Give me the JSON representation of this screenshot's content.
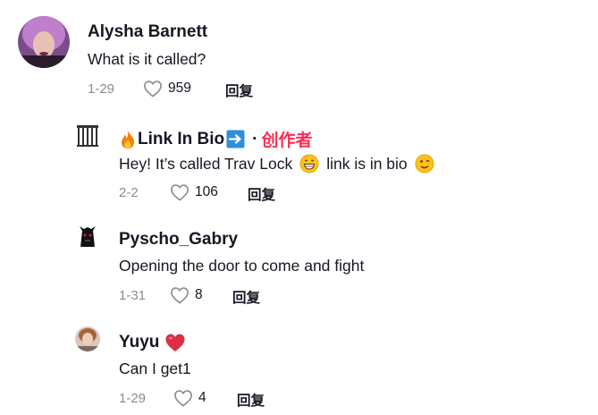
{
  "comments": [
    {
      "username": "Alysha Barnett",
      "text": "What is it called?",
      "date": "1-29",
      "likes": "959",
      "reply_label": "回复"
    },
    {
      "username": "Link In Bio",
      "separator": "·",
      "creator_tag": "创作者",
      "text_before": "Hey! It’s called Trav Lock",
      "text_middle": "link is in bio",
      "date": "2-2",
      "likes": "106",
      "reply_label": "回复"
    },
    {
      "username": "Pyscho_Gabry",
      "text": "Opening the door to come and fight",
      "date": "1-31",
      "likes": "8",
      "reply_label": "回复"
    },
    {
      "username": "Yuyu",
      "text": "Can I get1",
      "date": "1-29",
      "likes": "4",
      "reply_label": "回复"
    }
  ],
  "colors": {
    "creator": "#fe2c55",
    "meta": "#8a8b91",
    "text": "#161823"
  },
  "icons": [
    "heart-outline-icon",
    "fire-emoji",
    "arrow-right-emoji",
    "grin-emoji",
    "wink-emoji",
    "red-heart-emoji"
  ]
}
